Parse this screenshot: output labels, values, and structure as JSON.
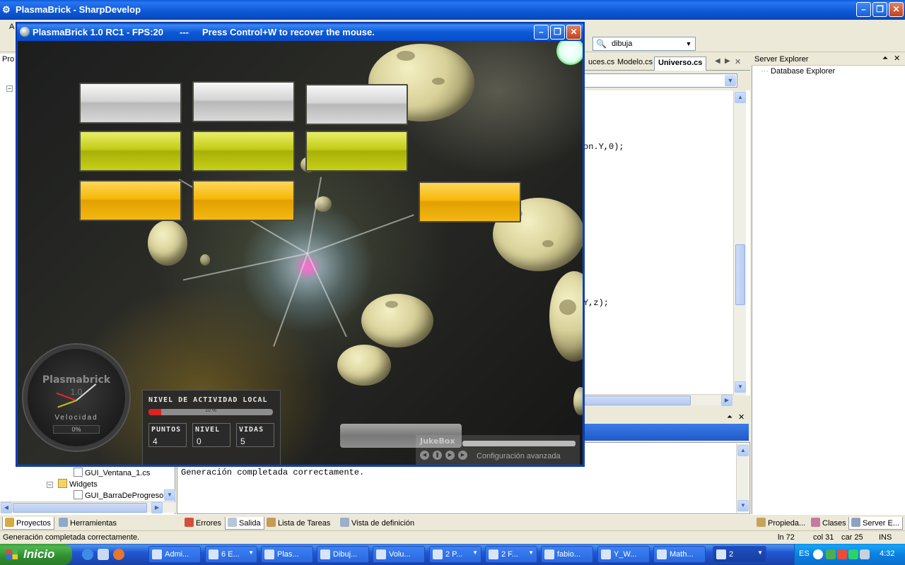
{
  "ide": {
    "title": "PlasmaBrick - SharpDevelop",
    "menu_first": "A",
    "toolbar_combo": "dibuja",
    "left_header": "Pro",
    "editor_tabs": [
      "uces.cs",
      "Modelo.cs",
      "Universo.cs"
    ],
    "code_lines": [
      "on.Y,0);",
      "Y,z);"
    ],
    "output_text": "Generación completada correctamente.",
    "tree": [
      {
        "label": "GUI_Ventana_1.cs"
      },
      {
        "label": "Widgets"
      },
      {
        "label": "GUI_BarraDeProgreso."
      }
    ],
    "bottom_tabs": {
      "left": [
        "Proyectos",
        "Herramientas"
      ],
      "center": [
        "Errores",
        "Salida",
        "Lista de Tareas",
        "Vista de definición"
      ],
      "right": [
        "Propieda...",
        "Clases",
        "Server E..."
      ]
    },
    "status": {
      "message": "Generación completada correctamente.",
      "line": "ln 72",
      "col": "col 31",
      "car": "car 25",
      "mode": "INS"
    },
    "server_explorer": {
      "title": "Server Explorer",
      "item": "Database Explorer"
    }
  },
  "game": {
    "title": "PlasmaBrick 1.0 RC1 - FPS:20",
    "separator": "---",
    "message": "Press Control+W to recover the mouse.",
    "hud": {
      "gauge_title": "Plasmabrick",
      "gauge_sub_title": "1.0",
      "speed_label": "Velocidad",
      "speed_value": "0%",
      "activity_label": "NIVEL DE ACTIVIDAD LOCAL",
      "activity_percent": 10,
      "activity_text": "10 %",
      "points_label": "PUNTOS",
      "points_value": "4",
      "level_label": "NIVEL",
      "level_value": "0",
      "lives_label": "VIDAS",
      "lives_value": "5"
    },
    "jukebox": {
      "name": "JukeBox",
      "config": "Configuración avanzada"
    }
  },
  "taskbar": {
    "start": "Inicio",
    "tasks": [
      "Admi...",
      "6 E...",
      "Plas...",
      "Dibuj...",
      "Volu...",
      "2 P...",
      "2 F...",
      "fabio...",
      "Y_W...",
      "Math...",
      "2"
    ],
    "lang": "ES",
    "clock": "4:32"
  },
  "colors": {
    "xp_blue": "#0b58d6",
    "start_green": "#3c9a3c",
    "brick_grey": "#d4d4d4",
    "brick_lime": "#c4cc16",
    "brick_orange": "#f6b80a"
  }
}
